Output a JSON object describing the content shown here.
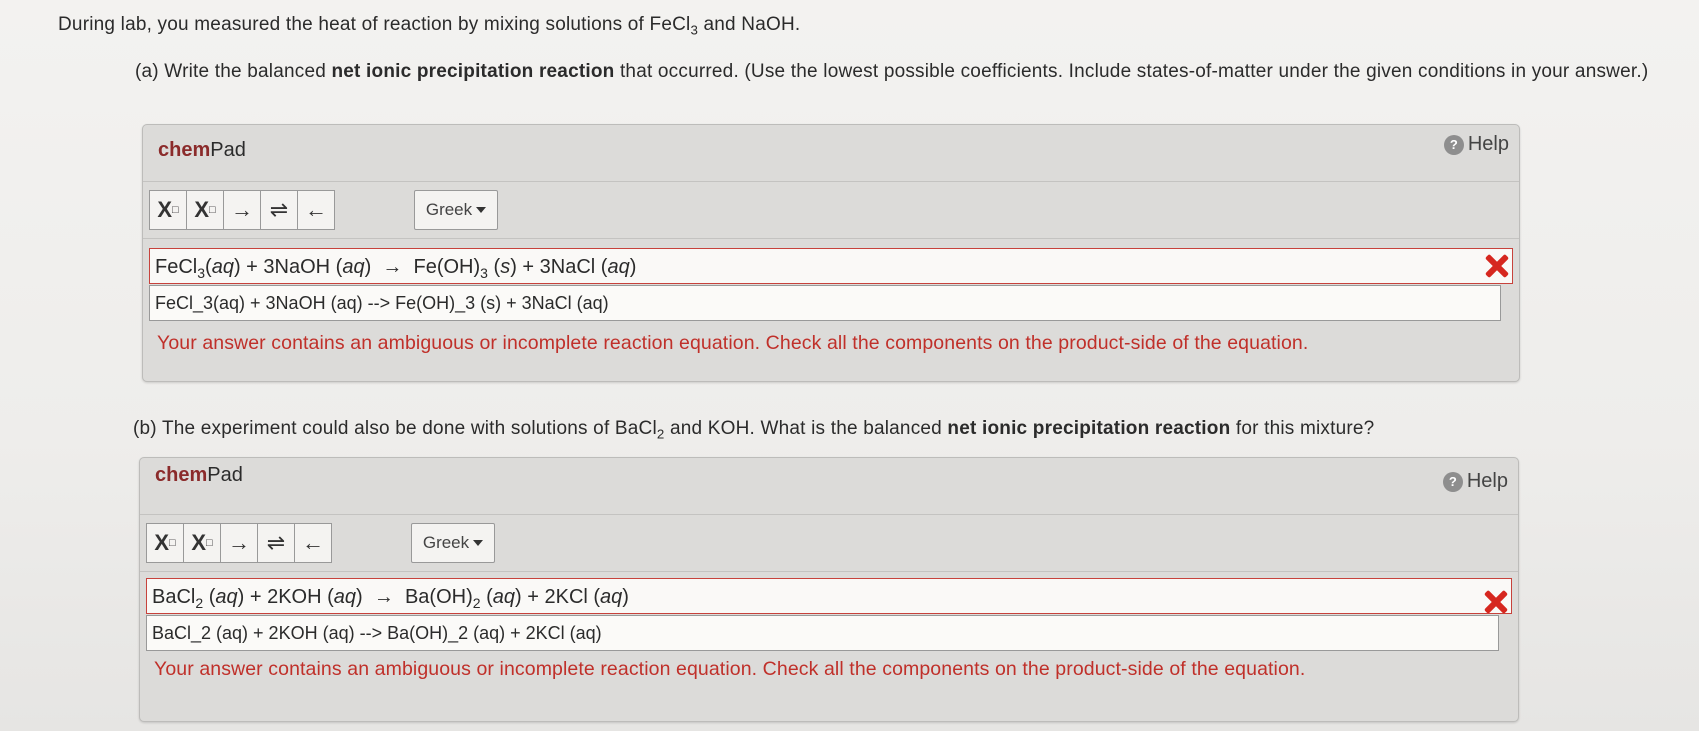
{
  "intro": {
    "before": "During lab, you measured the heat of reaction by mixing solutions of FeCl",
    "sub": "3",
    "after": " and NaOH."
  },
  "part_a": {
    "prefix": "(a) Write the balanced ",
    "bold": "net ionic precipitation reaction",
    "suffix": " that occurred. (Use the lowest possible coefficients. Include states-of-matter under the given conditions in your answer.)",
    "chempad": {
      "brand": "chem",
      "title": "Pad",
      "help": "Help",
      "greek": "Greek",
      "rendered": {
        "r1": "FeCl",
        "r1_sub": "3",
        "r1_state": "aq",
        "r2": " + 3NaOH (",
        "r2_state": "aq",
        "r2_close": ")",
        "arrow": "→",
        "p1": "Fe(OH)",
        "p1_sub": "3",
        "p1_state": "s",
        "p2": " + 3NaCl (",
        "p2_state": "aq",
        "p2_close": ")"
      },
      "raw_input": "FeCl_3(aq) + 3NaOH (aq) --> Fe(OH)_3 (s) + 3NaCl (aq)",
      "feedback": "Your answer contains an ambiguous or incomplete reaction equation. Check all the components on the product-side of the equation."
    }
  },
  "part_b": {
    "prefix": "(b) The experiment could also be done with solutions of BaCl",
    "sub": "2",
    "middle": " and KOH. What is the balanced ",
    "bold": "net ionic precipitation reaction",
    "suffix": " for this mixture?",
    "chempad": {
      "brand": "chem",
      "title": "Pad",
      "help": "Help",
      "greek": "Greek",
      "rendered": {
        "r1": "BaCl",
        "r1_sub": "2",
        "r1_state": "aq",
        "r2": " + 2KOH (",
        "r2_state": "aq",
        "r2_close": ")",
        "arrow": "→",
        "p1": "Ba(OH)",
        "p1_sub": "2",
        "p1_state": "aq",
        "p2": " + 2KCl (",
        "p2_state": "aq",
        "p2_close": ")"
      },
      "raw_input": "BaCl_2 (aq) + 2KOH (aq) --> Ba(OH)_2 (aq) + 2KCl (aq)",
      "feedback": "Your answer contains an ambiguous or incomplete reaction equation. Check all the components on the product-side of the equation."
    }
  },
  "toolbar": {
    "subscript": "X",
    "superscript": "X",
    "box": "□",
    "arrow_right": "→",
    "equilibrium": "⇌",
    "arrow_left": "←"
  },
  "icons": {
    "help": "help-icon",
    "incorrect": "red-x-icon",
    "dropdown": "caret-down-icon"
  },
  "colors": {
    "brand": "#8b2b2b",
    "error": "#c0302a",
    "x_mark": "#d6271f"
  }
}
